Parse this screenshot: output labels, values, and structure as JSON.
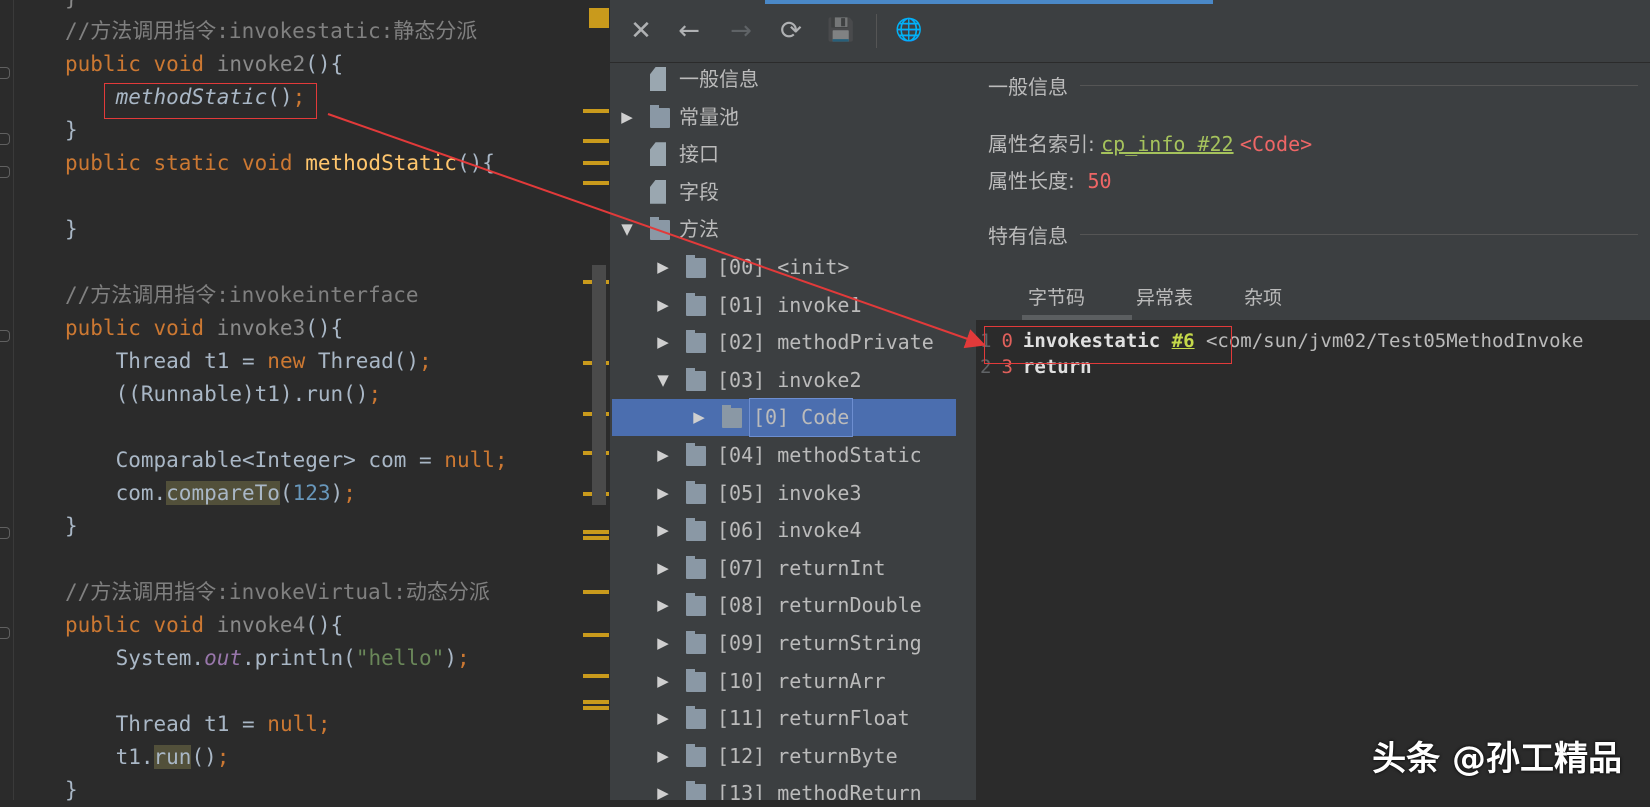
{
  "code": [
    [
      [
        "}",
        "t-gr"
      ]
    ],
    [
      [
        "//方法调用指令:invokestatic:静态分派",
        "t-cm"
      ]
    ],
    [
      [
        "public void ",
        "t-kw"
      ],
      [
        "invoke2",
        "t-gr"
      ],
      [
        "(){",
        ""
      ]
    ],
    [
      [
        "    ",
        ""
      ],
      [
        "methodStatic",
        "t-it"
      ],
      [
        "()",
        ""
      ],
      [
        ";",
        "t-semi"
      ]
    ],
    [
      [
        "}",
        ""
      ]
    ],
    [
      [
        "public static void ",
        "t-kw"
      ],
      [
        "methodStatic",
        "t-fn"
      ],
      [
        "(){",
        ""
      ]
    ],
    [],
    [
      [
        "}",
        ""
      ]
    ],
    [],
    [
      [
        "//方法调用指令:invokeinterface",
        "t-cm"
      ]
    ],
    [
      [
        "public void ",
        "t-kw"
      ],
      [
        "invoke3",
        "t-gr"
      ],
      [
        "(){",
        ""
      ]
    ],
    [
      [
        "    Thread t1 = ",
        ""
      ],
      [
        "new ",
        "t-kw"
      ],
      [
        "Thread()",
        ""
      ],
      [
        ";",
        "t-semi"
      ]
    ],
    [
      [
        "    ((Runnable)t1).run()",
        ""
      ],
      [
        ";",
        "t-semi"
      ]
    ],
    [],
    [
      [
        "    Comparable<Integer> com = ",
        ""
      ],
      [
        "null",
        "t-kw"
      ],
      [
        ";",
        "t-semi"
      ]
    ],
    [
      [
        "    com.",
        ""
      ],
      [
        "compareTo",
        "t-hl"
      ],
      [
        "(",
        ""
      ],
      [
        "123",
        "t-num"
      ],
      [
        ")",
        ""
      ],
      [
        ";",
        "t-semi"
      ]
    ],
    [
      [
        "}",
        ""
      ]
    ],
    [],
    [
      [
        "//方法调用指令:invokeVirtual:动态分派",
        "t-cm"
      ]
    ],
    [
      [
        "public void ",
        "t-kw"
      ],
      [
        "invoke4",
        "t-gr"
      ],
      [
        "(){",
        ""
      ]
    ],
    [
      [
        "    System.",
        ""
      ],
      [
        "out",
        "t-st"
      ],
      [
        ".println(",
        ""
      ],
      [
        "\"hello\"",
        "t-str"
      ],
      [
        ")",
        ""
      ],
      [
        ";",
        "t-semi"
      ]
    ],
    [],
    [
      [
        "    Thread t1 = ",
        ""
      ],
      [
        "null",
        "t-kw"
      ],
      [
        ";",
        "t-semi"
      ]
    ],
    [
      [
        "    t1.",
        ""
      ],
      [
        "run",
        "t-hl"
      ],
      [
        "()",
        ""
      ],
      [
        ";",
        "t-semi"
      ]
    ],
    [
      [
        "}",
        ""
      ]
    ]
  ],
  "toolbar": {
    "close": "✕",
    "back": "←",
    "forward": "→",
    "refresh": "⟳",
    "save": "💾",
    "web": "🌐"
  },
  "tree": [
    {
      "label": "一般信息",
      "level": 0,
      "arrow": "",
      "icon": "file"
    },
    {
      "label": "常量池",
      "level": 0,
      "arrow": "▶",
      "icon": "folder"
    },
    {
      "label": "接口",
      "level": 0,
      "arrow": "",
      "icon": "file"
    },
    {
      "label": "字段",
      "level": 0,
      "arrow": "",
      "icon": "file"
    },
    {
      "label": "方法",
      "level": 0,
      "arrow": "▼",
      "icon": "folder"
    },
    {
      "label": "[00] <init>",
      "level": 1,
      "arrow": "▶",
      "icon": "folder"
    },
    {
      "label": "[01] invoke1",
      "level": 1,
      "arrow": "▶",
      "icon": "folder"
    },
    {
      "label": "[02] methodPrivate",
      "level": 1,
      "arrow": "▶",
      "icon": "folder"
    },
    {
      "label": "[03] invoke2",
      "level": 1,
      "arrow": "▼",
      "icon": "folder"
    },
    {
      "label": "[0] Code",
      "level": 2,
      "arrow": "▶",
      "icon": "folder",
      "selected": true
    },
    {
      "label": "[04] methodStatic",
      "level": 1,
      "arrow": "▶",
      "icon": "folder"
    },
    {
      "label": "[05] invoke3",
      "level": 1,
      "arrow": "▶",
      "icon": "folder"
    },
    {
      "label": "[06] invoke4",
      "level": 1,
      "arrow": "▶",
      "icon": "folder"
    },
    {
      "label": "[07] returnInt",
      "level": 1,
      "arrow": "▶",
      "icon": "folder"
    },
    {
      "label": "[08] returnDouble",
      "level": 1,
      "arrow": "▶",
      "icon": "folder"
    },
    {
      "label": "[09] returnString",
      "level": 1,
      "arrow": "▶",
      "icon": "folder"
    },
    {
      "label": "[10] returnArr",
      "level": 1,
      "arrow": "▶",
      "icon": "folder"
    },
    {
      "label": "[11] returnFloat",
      "level": 1,
      "arrow": "▶",
      "icon": "folder"
    },
    {
      "label": "[12] returnByte",
      "level": 1,
      "arrow": "▶",
      "icon": "folder"
    },
    {
      "label": "[13] methodReturn",
      "level": 1,
      "arrow": "▶",
      "icon": "folder"
    }
  ],
  "detail": {
    "general_title": "一般信息",
    "attr_name_label": "属性名索引:",
    "attr_name_link": "cp_info #22",
    "attr_name_value": "<Code>",
    "attr_len_label": "属性长度:",
    "attr_len_value": "50",
    "specific_title": "特有信息",
    "tabs": [
      "字节码",
      "异常表",
      "杂项"
    ],
    "bytecode": [
      {
        "line": "1",
        "offset": "0",
        "op": "invokestatic",
        "ref": "#6",
        "comment": "<com/sun/jvm02/Test05MethodInvoke"
      },
      {
        "line": "2",
        "offset": "3",
        "op": "return",
        "ref": "",
        "comment": ""
      }
    ]
  },
  "watermark": "头条 @孙工精品",
  "colors": {
    "keyword": "#cc7832",
    "selection": "#4b6eaf",
    "annotation": "#e23a3a"
  }
}
